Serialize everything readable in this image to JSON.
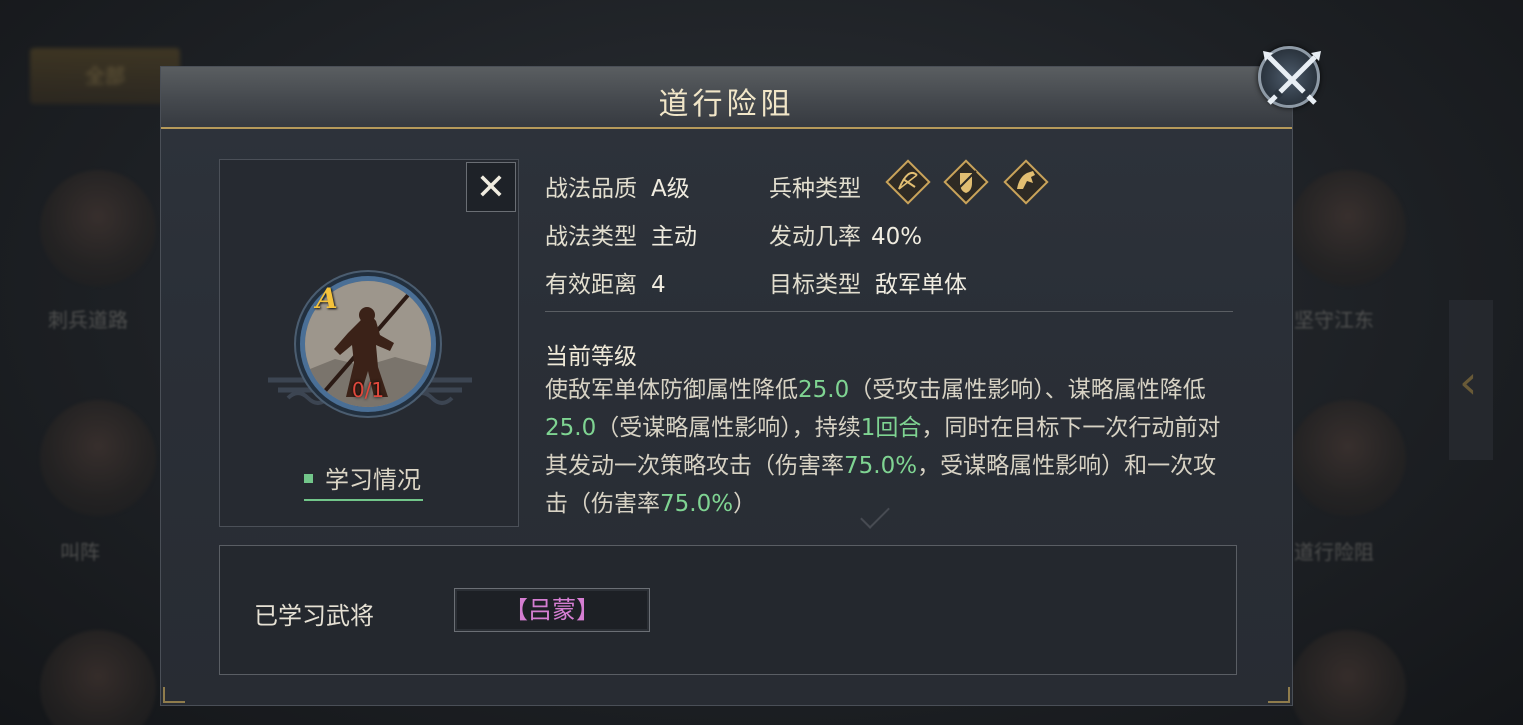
{
  "background": {
    "tab_label": "全部",
    "left_labels": [
      "刺兵道路",
      "叫阵"
    ],
    "right_labels": [
      "坚守江东",
      "道行险阻"
    ]
  },
  "dialog": {
    "title": "道行险阻",
    "close_icon": "crossed-swords-close-icon"
  },
  "skill": {
    "grade_letter": "A",
    "learn_count": "0/1",
    "learn_status_label": "学习情况",
    "close_label": "✕"
  },
  "attributes": {
    "quality_key": "战法品质",
    "quality_value": "A级",
    "type_key": "战法类型",
    "type_value": "主动",
    "range_key": "有效距离",
    "range_value": "4",
    "troop_key": "兵种类型",
    "troop_icons": [
      "archer-icon",
      "shield-icon",
      "cavalry-icon"
    ],
    "chance_key": "发动几率",
    "chance_value": "40%",
    "target_key": "目标类型",
    "target_value": "敌军单体"
  },
  "description": {
    "title": "当前等级",
    "parts": [
      {
        "t": "使敌军单体防御属性降低",
        "hl": false
      },
      {
        "t": "25.0",
        "hl": true
      },
      {
        "t": "（受攻击属性影响）、谋略属性降低",
        "hl": false
      },
      {
        "t": "25.0",
        "hl": true
      },
      {
        "t": "（受谋略属性影响），持续",
        "hl": false
      },
      {
        "t": "1回合",
        "hl": true
      },
      {
        "t": "，同时在目标下一次行动前对其发动一次策略攻击（伤害率",
        "hl": false
      },
      {
        "t": "75.0%",
        "hl": true
      },
      {
        "t": "，受谋略属性影响）和一次攻击（伤害率",
        "hl": false
      },
      {
        "t": "75.0%",
        "hl": true
      },
      {
        "t": "）",
        "hl": false
      }
    ]
  },
  "learned": {
    "label": "已学习武将",
    "general": "【吕蒙】"
  },
  "colors": {
    "highlight": "#7fd492",
    "gold": "#b69a5a",
    "general_name": "#d57ed2",
    "count_red": "#e0483c"
  }
}
